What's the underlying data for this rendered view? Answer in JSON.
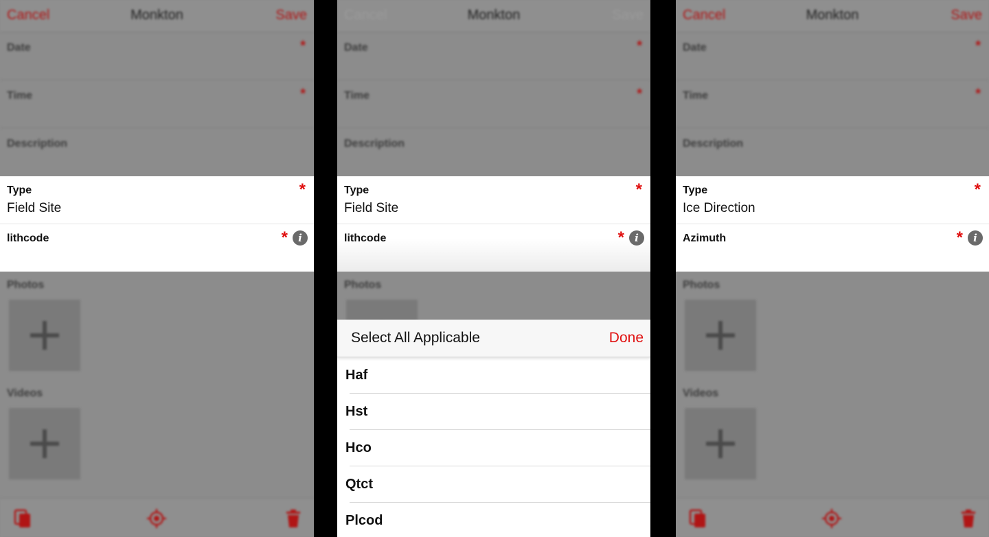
{
  "nav": {
    "cancel": "Cancel",
    "title": "Monkton",
    "save": "Save"
  },
  "form": {
    "date_label": "Date",
    "time_label": "Time",
    "description_label": "Description",
    "photos_label": "Photos",
    "videos_label": "Videos",
    "required_mark": "*"
  },
  "screens": [
    {
      "type_label": "Type",
      "type_value": "Field Site",
      "field2_label": "lithcode"
    },
    {
      "type_label": "Type",
      "type_value": "Field Site",
      "field2_label": "lithcode"
    },
    {
      "type_label": "Type",
      "type_value": "Ice Direction",
      "field2_label": "Azimuth"
    }
  ],
  "picker": {
    "title": "Select All Applicable",
    "done": "Done",
    "options": [
      "Haf",
      "Hst",
      "Hco",
      "Qtct",
      "Plcod"
    ]
  },
  "info_glyph": "i",
  "icons": [
    "copy-icon",
    "locate-icon",
    "trash-icon",
    "info-icon",
    "plus-icon"
  ],
  "colors": {
    "accent": "#e01010",
    "overlay": "#8c8c8c",
    "cell": "#ffffff"
  }
}
